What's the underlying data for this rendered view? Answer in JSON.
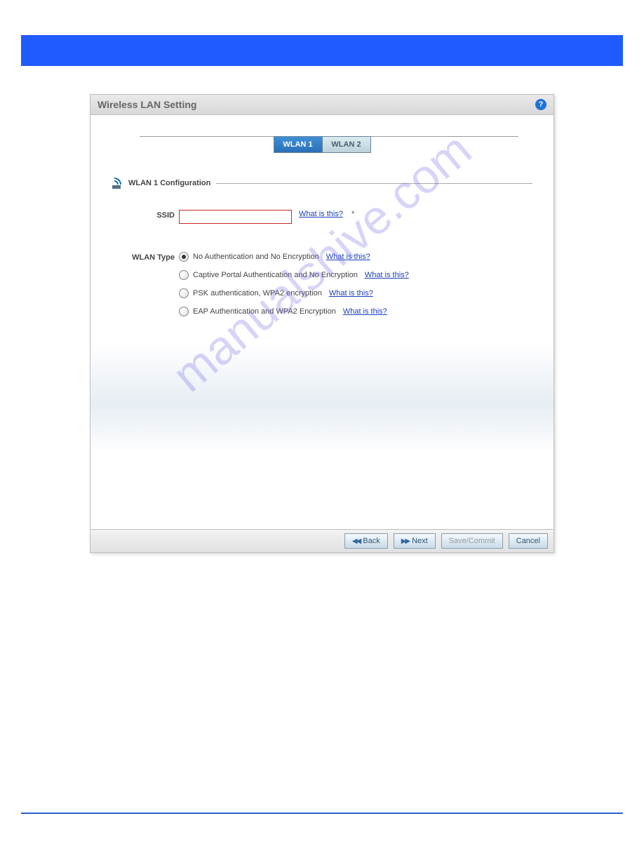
{
  "panel": {
    "title": "Wireless LAN Setting"
  },
  "tabs": {
    "wlan1": "WLAN 1",
    "wlan2": "WLAN 2"
  },
  "section": {
    "title": "WLAN 1 Configuration"
  },
  "form": {
    "ssid_label": "SSID",
    "ssid_value": "",
    "wlan_type_label": "WLAN Type",
    "options": [
      {
        "label": "No Authentication and No Encryption",
        "checked": true
      },
      {
        "label": "Captive Portal Authentication and No Encryption",
        "checked": false
      },
      {
        "label": "PSK authentication, WPA2 encryption",
        "checked": false
      },
      {
        "label": "EAP Authentication and WPA2 Encryption",
        "checked": false
      }
    ],
    "help_link": "What is this?",
    "asterisk": "*"
  },
  "footer": {
    "back": "Back",
    "next": "Next",
    "save": "Save/Commit",
    "cancel": "Cancel"
  },
  "watermark": "manualshive.com"
}
